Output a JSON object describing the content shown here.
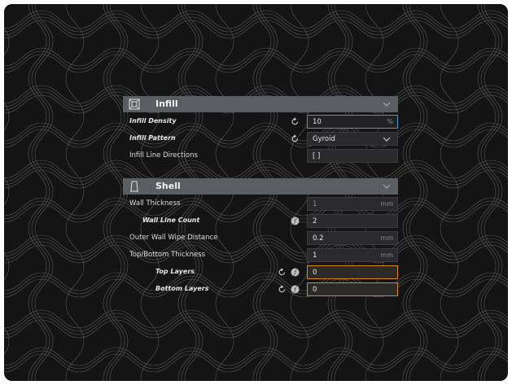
{
  "infill": {
    "title": "Infill",
    "icon": "infill-icon",
    "rows": [
      {
        "label": "Infill Density",
        "value": "10",
        "unit": "%"
      },
      {
        "label": "Infill Pattern",
        "value": "Gyroid"
      },
      {
        "label": "Infill Line Directions",
        "value": "[ ]"
      }
    ]
  },
  "shell": {
    "title": "Shell",
    "icon": "shell-icon",
    "rows": [
      {
        "label": "Wall Thickness",
        "value": "1",
        "unit": "mm"
      },
      {
        "label": "Wall Line Count",
        "value": "2"
      },
      {
        "label": "Outer Wall Wipe Distance",
        "value": "0.2",
        "unit": "mm"
      },
      {
        "label": "Top/Bottom Thickness",
        "value": "1",
        "unit": "mm"
      },
      {
        "label": "Top Layers",
        "value": "0"
      },
      {
        "label": "Bottom Layers",
        "value": "0"
      }
    ]
  },
  "colors": {
    "background": "#141414",
    "header": "#5a5d62",
    "panel": "#2e2e30",
    "focus_border": "#4a97c7",
    "warning_border": "#d98a18"
  }
}
